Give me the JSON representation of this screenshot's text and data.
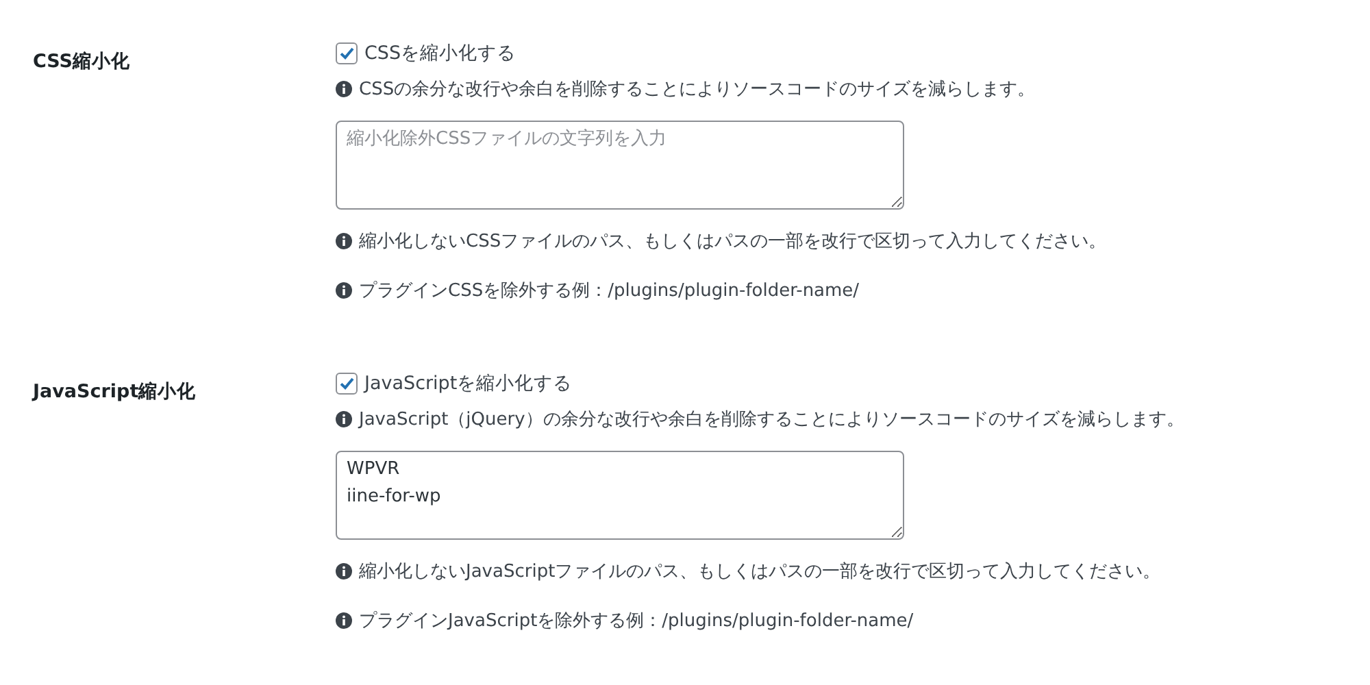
{
  "sections": [
    {
      "label": "CSS縮小化",
      "checkbox": {
        "label": "CSSを縮小化する",
        "checked": true
      },
      "description": "CSSの余分な改行や余白を削除することによりソースコードのサイズを減らします。",
      "textarea": {
        "placeholder": "縮小化除外CSSファイルの文字列を入力"
      },
      "notes": [
        "縮小化しないCSSファイルのパス、もしくはパスの一部を改行で区切って入力してください。",
        "プラグインCSSを除外する例：/plugins/plugin-folder-name/"
      ]
    },
    {
      "label": "JavaScript縮小化",
      "checkbox": {
        "label": "JavaScriptを縮小化する",
        "checked": true
      },
      "description": "JavaScript（jQuery）の余分な改行や余白を削除することによりソースコードのサイズを減らします。",
      "textarea": {
        "value": "WPVR\niine-for-wp"
      },
      "notes": [
        "縮小化しないJavaScriptファイルのパス、もしくはパスの一部を改行で区切って入力してください。",
        "プラグインJavaScriptを除外する例：/plugins/plugin-folder-name/"
      ]
    }
  ]
}
